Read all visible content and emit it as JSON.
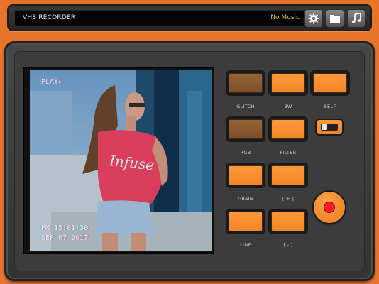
{
  "topbar": {
    "title": "VHS RECORDER",
    "music_status": "No Music",
    "buttons": [
      {
        "icon": "gear-icon"
      },
      {
        "icon": "folder-icon"
      },
      {
        "icon": "music-note-icon"
      }
    ]
  },
  "preview": {
    "osd_top": "PLAY▸",
    "osd_time": "PM 15:01:30",
    "osd_date": "SEP 07 2017",
    "shirt_text": "Infuse"
  },
  "controls": {
    "glitch_label": "GLITCH",
    "bw_label": "BW",
    "self_label": "SELF",
    "rgb_label": "RGB",
    "filter_label": "FILTER",
    "grain_label": "GRAIN",
    "plus_label": "[ + ]",
    "line_label": "LINE",
    "minus_label": "[ - ]",
    "active": [
      "GLITCH",
      "RGB"
    ]
  },
  "colors": {
    "accent": "#f08424",
    "record": "#ff1d1d",
    "music_text": "#e9c542"
  }
}
